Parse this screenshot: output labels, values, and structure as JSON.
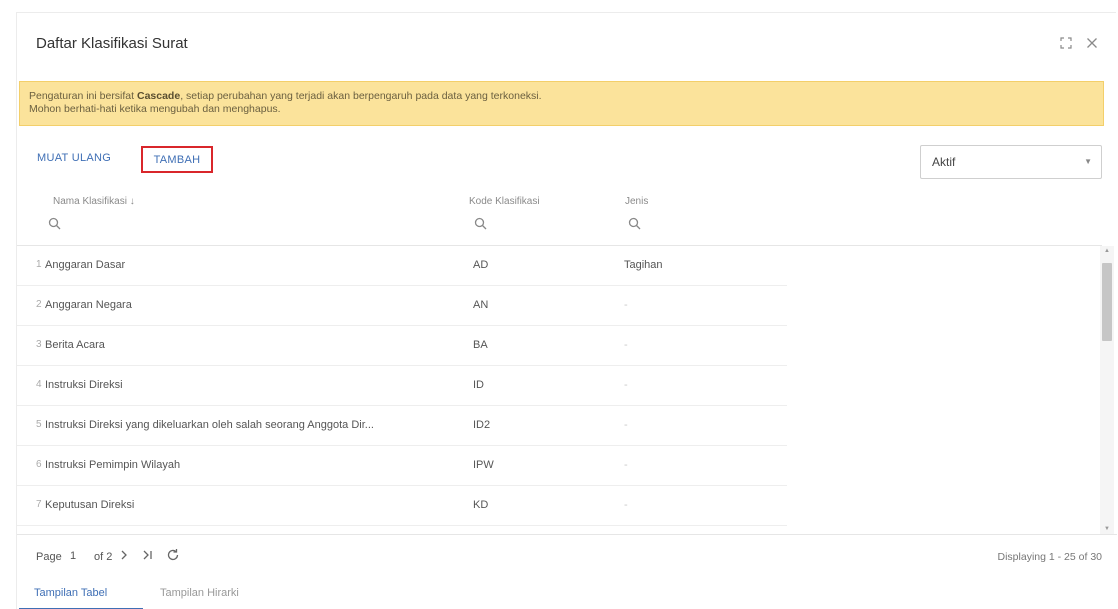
{
  "dialog": {
    "title": "Daftar Klasifikasi Surat",
    "maximize_icon": "maximize-icon",
    "close_icon": "close-icon"
  },
  "notice": {
    "line1_before": "Pengaturan ini bersifat ",
    "line1_bold": "Cascade",
    "line1_after": ", setiap perubahan yang terjadi akan berpengaruh pada data yang terkoneksi.",
    "line2": "Mohon berhati-hati ketika mengubah dan menghapus."
  },
  "toolbar": {
    "reload_label": "MUAT ULANG",
    "add_label": "TAMBAH",
    "status_select": "Aktif"
  },
  "columns": {
    "name": "Nama Klasifikasi",
    "name_sort": "↓",
    "code": "Kode Klasifikasi",
    "type": "Jenis"
  },
  "rows": [
    {
      "num": "1",
      "name": "Anggaran Dasar",
      "code": "AD",
      "type": "Tagihan"
    },
    {
      "num": "2",
      "name": "Anggaran Negara",
      "code": "AN",
      "type": "-"
    },
    {
      "num": "3",
      "name": "Berita Acara",
      "code": "BA",
      "type": "-"
    },
    {
      "num": "4",
      "name": "Instruksi Direksi",
      "code": "ID",
      "type": "-"
    },
    {
      "num": "5",
      "name": "Instruksi Direksi yang dikeluarkan oleh salah seorang Anggota Dir...",
      "code": "ID2",
      "type": "-"
    },
    {
      "num": "6",
      "name": "Instruksi Pemimpin Wilayah",
      "code": "IPW",
      "type": "-"
    },
    {
      "num": "7",
      "name": "Keputusan Direksi",
      "code": "KD",
      "type": "-"
    }
  ],
  "pager": {
    "page_label": "Page",
    "current_page": "1",
    "of_label": "of 2",
    "info": "Displaying 1 - 25 of 30"
  },
  "tabs": {
    "table": "Tampilan Tabel",
    "tree": "Tampilan Hirarki"
  },
  "colors": {
    "accent": "#3f6fb5",
    "notice_bg": "#fbe39b",
    "highlight_border": "#d9262b"
  }
}
